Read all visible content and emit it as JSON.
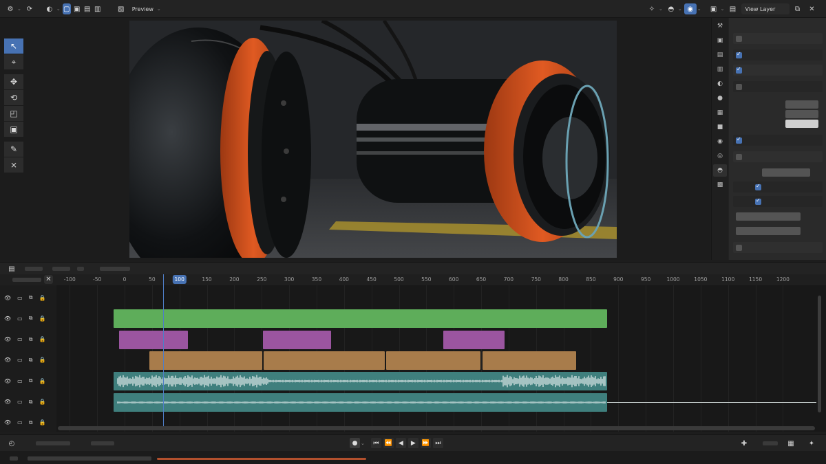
{
  "app": {
    "header": {
      "mode": "Preview",
      "view_layer": "View Layer"
    },
    "timeline": {
      "ticks": [
        "-100",
        "-50",
        "0",
        "50",
        "100",
        "150",
        "200",
        "250",
        "300",
        "350",
        "400",
        "450",
        "500",
        "550",
        "600",
        "650",
        "700",
        "750",
        "800",
        "850",
        "900",
        "950",
        "1000",
        "1050",
        "1100",
        "1150",
        "1200"
      ],
      "current_frame": "100"
    },
    "channels": [
      {
        "visible": true,
        "locked": false
      },
      {
        "visible": true,
        "locked": false
      },
      {
        "visible": true,
        "locked": false
      },
      {
        "visible": true,
        "locked": false
      },
      {
        "visible": true,
        "locked": false
      },
      {
        "visible": true,
        "locked": false
      },
      {
        "visible": true,
        "locked": false
      }
    ],
    "strips": [
      {
        "channel": 2,
        "type": "scene",
        "start": -20,
        "end": 880,
        "color": "#5ead5a"
      },
      {
        "channel": 3,
        "type": "meta",
        "start": -10,
        "end": 116,
        "color": "#9b55a0"
      },
      {
        "channel": 3,
        "type": "meta",
        "start": 252,
        "end": 376,
        "color": "#9b55a0"
      },
      {
        "channel": 3,
        "type": "meta",
        "start": 581,
        "end": 693,
        "color": "#9b55a0"
      },
      {
        "channel": 4,
        "type": "image",
        "start": 45,
        "end": 251,
        "color": "#a87c4b"
      },
      {
        "channel": 4,
        "type": "image",
        "start": 254,
        "end": 474,
        "color": "#a87c4b"
      },
      {
        "channel": 4,
        "type": "image",
        "start": 477,
        "end": 649,
        "color": "#a87c4b"
      },
      {
        "channel": 4,
        "type": "image",
        "start": 652,
        "end": 823,
        "color": "#a87c4b"
      },
      {
        "channel": 5,
        "type": "sound",
        "start": -20,
        "end": 880,
        "color": "#3f7f7d"
      },
      {
        "channel": 6,
        "type": "sound",
        "start": -20,
        "end": 880,
        "color": "#3f7f7d"
      }
    ],
    "colors": {
      "accent": "#4772b3",
      "scene_strip": "#5ead5a",
      "meta_strip": "#9b55a0",
      "image_strip": "#a87c4b",
      "sound_strip": "#3f7f7d",
      "render_orange": "#d4531f"
    }
  }
}
